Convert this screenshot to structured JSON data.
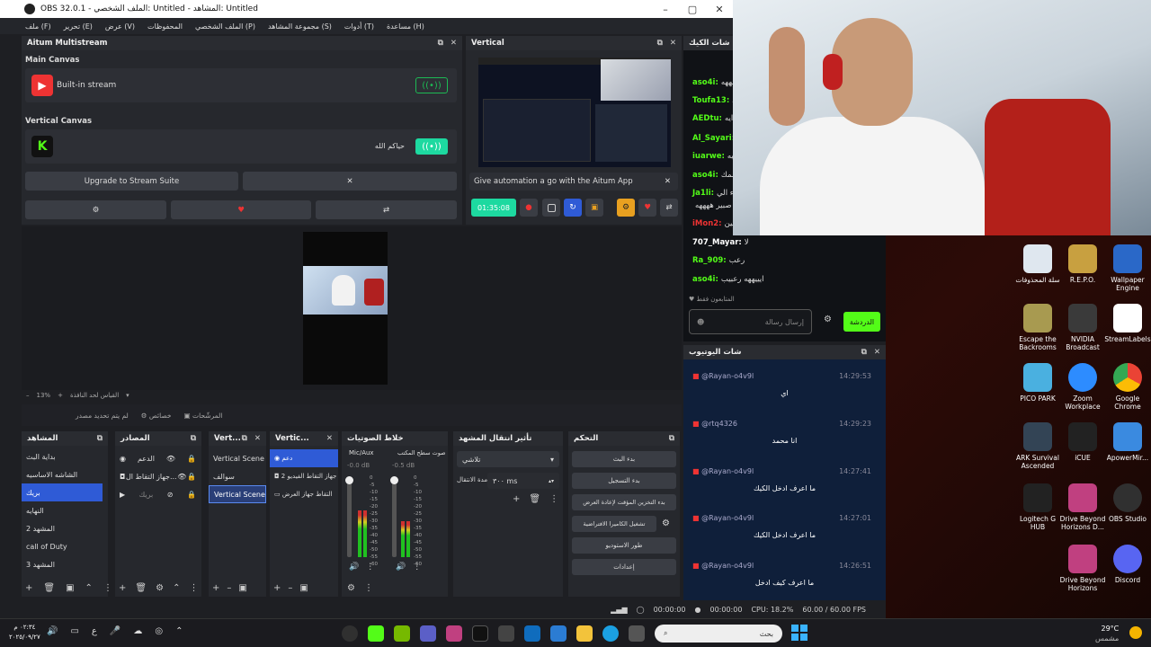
{
  "window": {
    "title": "OBS 32.0.1 - الملف الشخصي: Untitled - المشاهد: Untitled"
  },
  "menu": [
    "ملف (F)",
    "تحرير (E)",
    "عرض (V)",
    "المحفوظات",
    "الملف الشخصي (P)",
    "مجموعة المشاهد (S)",
    "أدوات (T)",
    "مساعدة (H)"
  ],
  "aitum": {
    "title": "Aitum Multistream",
    "main_canvas": "Main Canvas",
    "builtin": "Built-in stream",
    "vertical_canvas": "Vertical Canvas",
    "vert_label": "حياكم الله",
    "upgrade": "Upgrade to Stream Suite",
    "close": "✕"
  },
  "vertical": {
    "title": "Vertical",
    "promo": "Give automation a go with the Aitum App",
    "timer": "01:35:08"
  },
  "preview": {
    "zoom": "13%",
    "fit_label": "القياس لحد النافذة"
  },
  "source_toolbar": {
    "no_source": "لم يتم تحديد مصدر",
    "props": "خصائص",
    "filters": "المرشّحات"
  },
  "scenes": {
    "title": "المشاهد",
    "items": [
      "بداية البث",
      "الشاشه الاساسيه",
      "بريك",
      "النهايه",
      "المشهد 2",
      "call of Duty",
      "المشهد 3"
    ],
    "selected": 2
  },
  "sources": {
    "title": "المصادر",
    "items": [
      "الدعم",
      "جهاز التقاط ال...",
      "بريك"
    ]
  },
  "vert1": {
    "title": "Vert...",
    "items": [
      "Vertical Scene",
      "سوالف",
      "Vertical Scene"
    ],
    "selected": 2
  },
  "vert2": {
    "title": "Vertic...",
    "items": [
      "دعم",
      "جهاز التقاط الفيديو 2",
      "التقاط جهاز العرض"
    ]
  },
  "mixer": {
    "title": "خلاط الصوتيات",
    "ch1": {
      "name": "Mic/Aux",
      "db": "-0.0 dB"
    },
    "ch2": {
      "name": "صوت سطح المكتب",
      "db": "-0.5 dB"
    },
    "scale": [
      "0",
      "-5",
      "-10",
      "-15",
      "-20",
      "-25",
      "-30",
      "-35",
      "-40",
      "-45",
      "-50",
      "-55",
      "-60"
    ]
  },
  "transitions": {
    "title": "تأثير انتقال المشهد",
    "type": "تلاشي",
    "duration_label": "مدة الانتقال",
    "duration": "٣٠٠ ms"
  },
  "controls": {
    "title": "التحكم",
    "buttons": [
      "بدء البث",
      "بدء التسجيل",
      "بدء التخزين المؤقت لإعادة العرض",
      "تشغيل الكاميرا الافتراضية",
      "طور الاستوديو",
      "إعدادات"
    ]
  },
  "status": {
    "rec": "00:00:00",
    "stream": "00:00:00",
    "cpu": "CPU: 18.2%",
    "fps": "60.00 / 60.00 FPS"
  },
  "kick_chat": {
    "title": "شات الكيك",
    "lines": [
      {
        "user": "aso4i:",
        "msg": "هههههه"
      },
      {
        "user": "Toufa13:",
        "msg": "ي"
      },
      {
        "user": "AEDtu:",
        "msg": "ايه"
      },
      {
        "user": "Al_Sayari:",
        "msg": "ي"
      },
      {
        "user": "iuarwe:",
        "msg": "ايه"
      },
      {
        "user": "aso4i:",
        "msg": "سمك"
      },
      {
        "user": "Ja1li:",
        "msg": "جاء الي"
      },
      {
        "user": "",
        "msg": "صبير ههههه"
      },
      {
        "user": "iMon2:",
        "msg": "يبين"
      },
      {
        "user": "707_Mayar:",
        "msg": "لا"
      },
      {
        "user": "Ra_909:",
        "msg": "رعب"
      },
      {
        "user": "aso4i:",
        "msg": "ايييههه رعبيب"
      }
    ],
    "followers_only": "المتابعون فقط",
    "send_placeholder": "إرسال رسالة",
    "chat_btn": "الدردشة"
  },
  "yt_chat": {
    "title": "شات اليوتيوب",
    "messages": [
      {
        "user": "@Rayan-o4v9l",
        "time": "14:29:53",
        "text": "اي"
      },
      {
        "user": "@rtq4326",
        "time": "14:29:23",
        "text": "انا محمد"
      },
      {
        "user": "@Rayan-o4v9l",
        "time": "14:27:41",
        "text": "ما اعرف ادخل الكيك"
      },
      {
        "user": "@Rayan-o4v9l",
        "time": "14:27:01",
        "text": "ما اعرف ادخل الكيك"
      },
      {
        "user": "@Rayan-o4v9l",
        "time": "14:26:51",
        "text": "ما اعرف كيف ادخل"
      }
    ]
  },
  "desktop_icons": [
    {
      "label": "سلة المحذوفات",
      "color": "#dfe7ef"
    },
    {
      "label": "R.E.P.O.",
      "color": "#c8a040"
    },
    {
      "label": "Wallpaper Engine",
      "color": "#2a68c8"
    },
    {
      "label": "Escape the Backrooms",
      "color": "#a89a50"
    },
    {
      "label": "NVIDIA Broadcast",
      "color": "#3a3a3a"
    },
    {
      "label": "StreamLabels",
      "color": "#ffffff"
    },
    {
      "label": "PICO PARK",
      "color": "#4ab0e0"
    },
    {
      "label": "Zoom Workplace",
      "color": "#2d8cff"
    },
    {
      "label": "Google Chrome",
      "color": "#e0e0e0"
    },
    {
      "label": "ARK Survival Ascended",
      "color": "#334455"
    },
    {
      "label": "iCUE",
      "color": "#222222"
    },
    {
      "label": "ApowerMir...",
      "color": "#3a8ae0"
    },
    {
      "label": "Logitech G HUB",
      "color": "#222222"
    },
    {
      "label": "Drive Beyond Horizons D...",
      "color": "#c04080"
    },
    {
      "label": "OBS Studio",
      "color": "#303030"
    },
    {
      "label": "Drive Beyond Horizons",
      "color": "#c04080"
    },
    {
      "label": "Discord",
      "color": "#5865f2"
    }
  ],
  "taskbar": {
    "search": "بحث",
    "time": "٠٢:٣٤ م",
    "date": "٢٠٢٥/٠٩/٢٧",
    "weather_temp": "29°C",
    "weather_desc": "مشمس",
    "lang": "ع"
  }
}
